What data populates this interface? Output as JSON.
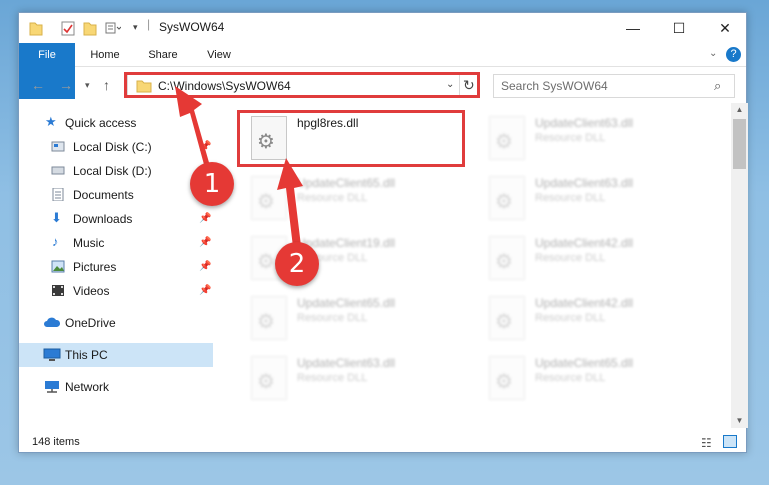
{
  "window": {
    "title": "SysWOW64",
    "controls": {
      "minimize": "—",
      "maximize": "☐",
      "close": "✕"
    }
  },
  "ribbon": {
    "tabs": [
      "File",
      "Home",
      "Share",
      "View"
    ]
  },
  "address": {
    "path": "C:\\Windows\\SysWOW64",
    "search_placeholder": "Search SysWOW64"
  },
  "nav": {
    "items": [
      {
        "label": "Quick access",
        "icon": "star-icon"
      },
      {
        "label": "Local Disk (C:)",
        "icon": "drive-icon",
        "pinned": true
      },
      {
        "label": "Local Disk (D:)",
        "icon": "drive-icon"
      },
      {
        "label": "Documents",
        "icon": "document-icon",
        "pinned": true
      },
      {
        "label": "Downloads",
        "icon": "download-icon",
        "pinned": true
      },
      {
        "label": "Music",
        "icon": "music-icon",
        "pinned": true
      },
      {
        "label": "Pictures",
        "icon": "picture-icon",
        "pinned": true
      },
      {
        "label": "Videos",
        "icon": "video-icon",
        "pinned": true
      },
      {
        "label": "OneDrive",
        "icon": "cloud-icon"
      },
      {
        "label": "This PC",
        "icon": "computer-icon",
        "selected": true
      },
      {
        "label": "Network",
        "icon": "network-icon"
      }
    ]
  },
  "files": [
    {
      "name": "hpgl8res.dll",
      "type": "",
      "highlight": true
    },
    {
      "name": "UpdateClient63.dll",
      "type": "Resource DLL"
    },
    {
      "name": "UpdateClient65.dll",
      "type": "Resource DLL"
    },
    {
      "name": "UpdateClient63.dll",
      "type": "Resource DLL"
    },
    {
      "name": "UpdateClient19.dll",
      "type": "Resource DLL"
    },
    {
      "name": "UpdateClient42.dll",
      "type": "Resource DLL"
    },
    {
      "name": "UpdateClient65.dll",
      "type": "Resource DLL"
    },
    {
      "name": "UpdateClient42.dll",
      "type": "Resource DLL"
    },
    {
      "name": "UpdateClient63.dll",
      "type": "Resource DLL"
    },
    {
      "name": "UpdateClient65.dll",
      "type": "Resource DLL"
    }
  ],
  "status": {
    "item_count": "148 items"
  },
  "annotations": {
    "step1": "1",
    "step2": "2",
    "color": "#e03c3c"
  }
}
